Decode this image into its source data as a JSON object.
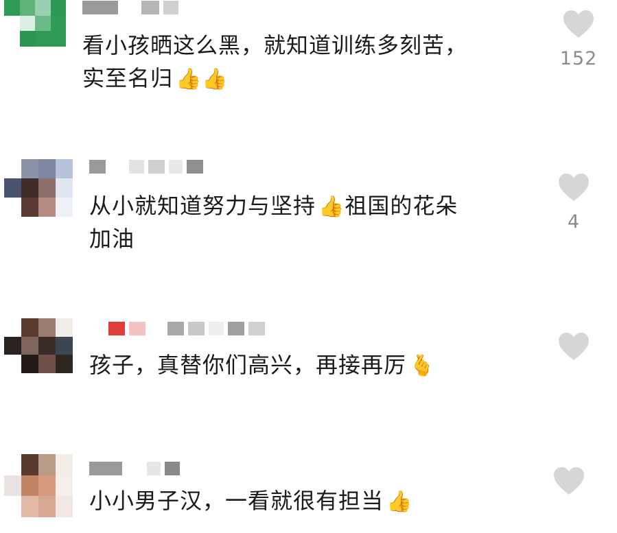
{
  "comments": [
    {
      "line1": "看小孩晒这么黑，就知道训练多刻苦，",
      "line2": "实至名归",
      "line2_emojis": "👍👍",
      "likes": "152"
    },
    {
      "line1": "从小就知道努力与坚持",
      "line1_emoji": "👍",
      "line1_after": "祖国的花朵",
      "line2": "加油",
      "likes": "4"
    },
    {
      "line1": "孩子，真替你们高兴，再接再厉",
      "line1_emoji": "🫰",
      "likes": ""
    },
    {
      "line1": "小小男子汉，一看就很有担当",
      "line1_emoji": "👍",
      "likes": ""
    }
  ],
  "icons": {
    "like": "heart-icon",
    "avatar": "pixelated-avatar"
  },
  "colors": {
    "heart": "#d6d6d6",
    "count": "#8a8a8a",
    "text": "#1a1a1a"
  }
}
